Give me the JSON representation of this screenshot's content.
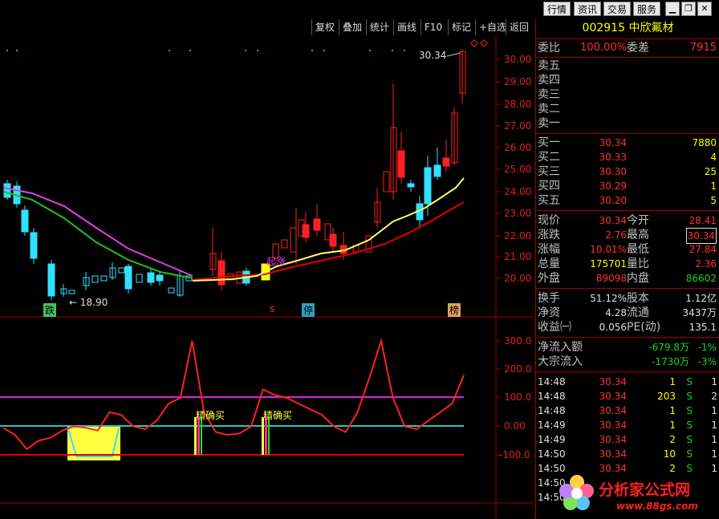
{
  "topbar": {
    "buttons": [
      "行情",
      "资讯",
      "交易",
      "服务"
    ],
    "win_icons": [
      "minimize-icon",
      "restore-icon",
      "close-icon"
    ]
  },
  "toolbar": {
    "items": [
      "复权",
      "叠加",
      "统计",
      "画线",
      "F10",
      "标记",
      "+自选",
      "返回"
    ]
  },
  "chart": {
    "price_labels": [
      "30.00",
      "29.00",
      "28.00",
      "27.00",
      "26.00",
      "25.00",
      "24.00",
      "23.00",
      "22.00",
      "21.00",
      "20.00"
    ],
    "indicator_labels": [
      "300.0",
      "200.0",
      "100.0",
      "0.00",
      "-100.0"
    ],
    "high_marker": "30.34",
    "low_marker": "18.90",
    "tags": {
      "die": "跌",
      "qizhang": "起涨",
      "s": "s",
      "ting": "停",
      "bang": "榜"
    },
    "signals": [
      "精确买",
      "精确买"
    ],
    "colors": {
      "up": "#ff2020",
      "down": "#30e0ff",
      "ma1": "#ffff60",
      "ma2": "#e00000",
      "ma3": "#20c020",
      "ma4": "#e040e0"
    }
  },
  "chart_data": {
    "type": "line",
    "title": "",
    "series": [
      {
        "values": [
          -5,
          -30,
          -80,
          -50,
          -40,
          -15,
          0,
          -5,
          -15,
          50,
          40,
          0,
          -10,
          20,
          80,
          100,
          300,
          50,
          -20,
          -30,
          -25,
          0,
          130,
          110,
          100,
          80,
          60,
          40,
          0,
          -20,
          50,
          170,
          300,
          100,
          0,
          -10,
          20,
          50,
          80,
          180
        ]
      }
    ],
    "ylim": [
      -100,
      300
    ]
  },
  "panel": {
    "code": "002915",
    "name": "中欣氟材",
    "webi": {
      "label": "委比",
      "value": "100.00%"
    },
    "weicha": {
      "label": "委差",
      "value": "7915"
    },
    "sell": [
      "卖五",
      "卖四",
      "卖三",
      "卖二",
      "卖一"
    ],
    "buy": [
      {
        "label": "买一",
        "price": "30.34",
        "vol": "7880"
      },
      {
        "label": "买二",
        "price": "30.33",
        "vol": "4"
      },
      {
        "label": "买三",
        "price": "30.30",
        "vol": "25"
      },
      {
        "label": "买四",
        "price": "30.29",
        "vol": "1"
      },
      {
        "label": "买五",
        "price": "30.20",
        "vol": "5"
      }
    ],
    "quote": [
      {
        "l1": "现价",
        "v1": "30.34",
        "l2": "今开",
        "v2": "28.41"
      },
      {
        "l1": "涨跌",
        "v1": "2.76",
        "l2": "最高",
        "v2": "30.34"
      },
      {
        "l1": "涨幅",
        "v1": "10.01%",
        "l2": "最低",
        "v2": "27.84"
      },
      {
        "l1": "总量",
        "v1": "175701",
        "l2": "量比",
        "v2": "2.36"
      },
      {
        "l1": "外盘",
        "v1": "89098",
        "l2": "内盘",
        "v2": "86602"
      }
    ],
    "extra": [
      {
        "l1": "换手",
        "v1": "51.12%",
        "l2": "股本",
        "v2": "1.12亿"
      },
      {
        "l1": "净资",
        "v1": "4.28",
        "l2": "流通",
        "v2": "3437万"
      },
      {
        "l1": "收益㈠",
        "v1": "0.056",
        "l2": "PE(动)",
        "v2": "135.1"
      }
    ],
    "flow": [
      {
        "l": "净流入额",
        "v": "-679.8万",
        "p": "-1%"
      },
      {
        "l": "大宗流入",
        "v": "-1730万",
        "p": "-3%"
      }
    ],
    "ticks": [
      {
        "t": "14:48",
        "p": "30.34",
        "v": "1",
        "s": "S",
        "n": "1"
      },
      {
        "t": "14:48",
        "p": "30.34",
        "v": "203",
        "s": "S",
        "n": "2"
      },
      {
        "t": "14:48",
        "p": "30.34",
        "v": "1",
        "s": "S",
        "n": "1"
      },
      {
        "t": "14:49",
        "p": "30.34",
        "v": "1",
        "s": "S",
        "n": "1"
      },
      {
        "t": "14:49",
        "p": "30.34",
        "v": "2",
        "s": "S",
        "n": "1"
      },
      {
        "t": "14:50",
        "p": "30.34",
        "v": "10",
        "s": "S",
        "n": "1"
      },
      {
        "t": "14:50",
        "p": "30.34",
        "v": "2",
        "s": "S",
        "n": "1"
      },
      {
        "t": "14:50",
        "p": "",
        "v": "",
        "s": "",
        "n": ""
      },
      {
        "t": "14:50",
        "p": "",
        "v": "",
        "s": "",
        "n": ""
      }
    ],
    "watermark": "分析家公式网",
    "watermark_url": "www.88gs.com"
  }
}
